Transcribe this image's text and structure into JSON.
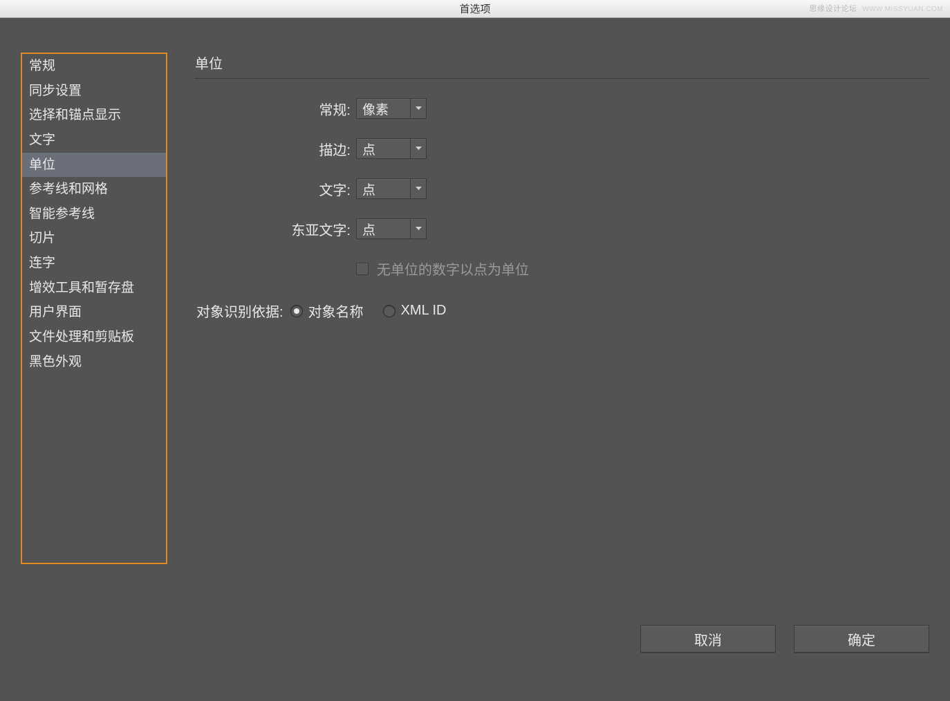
{
  "window": {
    "title": "首选项",
    "watermark1": "思缘设计论坛",
    "watermark2": "WWW.MISSYUAN.COM"
  },
  "sidebar": {
    "items": [
      {
        "label": "常规",
        "selected": false
      },
      {
        "label": "同步设置",
        "selected": false
      },
      {
        "label": "选择和锚点显示",
        "selected": false
      },
      {
        "label": "文字",
        "selected": false
      },
      {
        "label": "单位",
        "selected": true
      },
      {
        "label": "参考线和网格",
        "selected": false
      },
      {
        "label": "智能参考线",
        "selected": false
      },
      {
        "label": "切片",
        "selected": false
      },
      {
        "label": "连字",
        "selected": false
      },
      {
        "label": "增效工具和暂存盘",
        "selected": false
      },
      {
        "label": "用户界面",
        "selected": false
      },
      {
        "label": "文件处理和剪贴板",
        "selected": false
      },
      {
        "label": "黑色外观",
        "selected": false
      }
    ]
  },
  "content": {
    "section_title": "单位",
    "rows": [
      {
        "label": "常规:",
        "value": "像素"
      },
      {
        "label": "描边:",
        "value": "点"
      },
      {
        "label": "文字:",
        "value": "点"
      },
      {
        "label": "东亚文字:",
        "value": "点"
      }
    ],
    "checkbox": {
      "label": "无单位的数字以点为单位",
      "checked": false
    },
    "radio_group": {
      "label": "对象识别依据:",
      "options": [
        {
          "label": "对象名称",
          "selected": true
        },
        {
          "label": "XML ID",
          "selected": false
        }
      ]
    }
  },
  "buttons": {
    "cancel": "取消",
    "ok": "确定"
  }
}
